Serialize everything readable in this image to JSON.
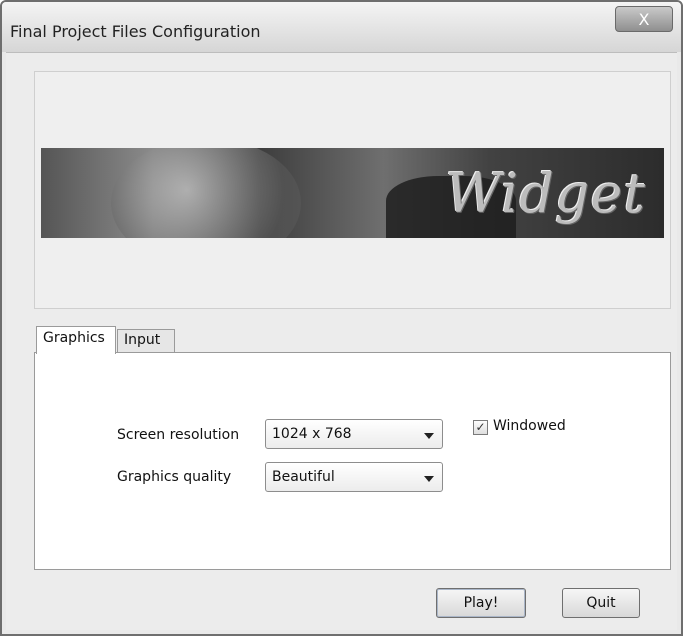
{
  "window": {
    "title": "Final Project Files Configuration",
    "close_label": "X"
  },
  "banner": {
    "logo_text": "Widget"
  },
  "tabs": [
    {
      "label": "Graphics",
      "selected": true
    },
    {
      "label": "Input",
      "selected": false
    }
  ],
  "graphics": {
    "resolution_label": "Screen resolution",
    "resolution_value": "1024 x 768",
    "quality_label": "Graphics quality",
    "quality_value": "Beautiful",
    "windowed_label": "Windowed",
    "windowed_checked": true,
    "check_glyph": "✓"
  },
  "buttons": {
    "play_label": "Play!",
    "quit_label": "Quit"
  },
  "icons": {
    "close": "close-icon",
    "dropdown": "chevron-down-icon",
    "checkbox": "checkmark-icon"
  }
}
